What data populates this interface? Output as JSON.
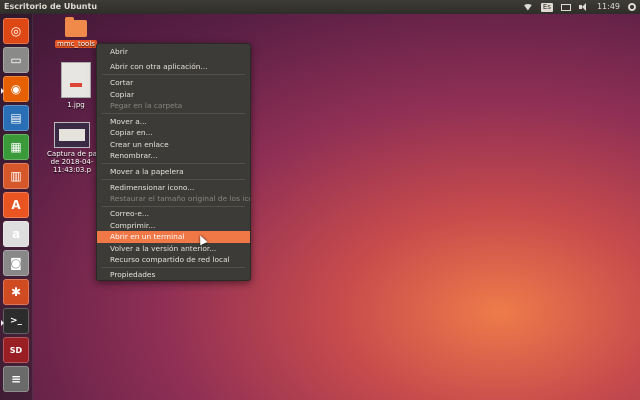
{
  "topbar": {
    "title": "Escritorio de Ubuntu",
    "keyboard_layout": "Es",
    "time": "11:49",
    "icons": [
      "wifi-icon",
      "keyboard-icon",
      "envelope-icon",
      "speaker-icon",
      "gear-icon"
    ]
  },
  "launcher": {
    "items": [
      {
        "name": "ubuntu-dash",
        "glyph": "◎",
        "color": "#dd4814"
      },
      {
        "name": "files",
        "glyph": "▭",
        "color": "#8a8a88"
      },
      {
        "name": "firefox",
        "glyph": "◉",
        "color": "#e66000"
      },
      {
        "name": "libreoffice-writer",
        "glyph": "▤",
        "color": "#2a6fb5"
      },
      {
        "name": "libreoffice-calc",
        "glyph": "▦",
        "color": "#3a9a3a"
      },
      {
        "name": "libreoffice-impress",
        "glyph": "▥",
        "color": "#d6572a"
      },
      {
        "name": "ubuntu-software",
        "glyph": "A",
        "color": "#e95420"
      },
      {
        "name": "amazon",
        "glyph": "a",
        "color": "#dedede"
      },
      {
        "name": "camera",
        "glyph": "◙",
        "color": "#888888"
      },
      {
        "name": "system-settings",
        "glyph": "✱",
        "color": "#d14b22"
      },
      {
        "name": "terminal",
        "glyph": ">_",
        "color": "#2c2c2c"
      },
      {
        "name": "sd-card",
        "glyph": "SD",
        "color": "#9a1f24"
      },
      {
        "name": "more",
        "glyph": "≡",
        "color": "#6a6a6a"
      }
    ]
  },
  "desktop": {
    "icons": [
      {
        "label": "mmc_tools",
        "type": "folder"
      },
      {
        "label": "1.jpg",
        "type": "image"
      },
      {
        "label_lines": [
          "Captura de pa",
          "de 2018-04-",
          "11:43:03.p"
        ],
        "type": "screenshot"
      }
    ]
  },
  "context_menu": {
    "items": [
      {
        "label": "Abrir",
        "state": "normal"
      },
      {
        "label": "Abrir con otra aplicación...",
        "state": "normal"
      },
      {
        "label": "Cortar",
        "state": "normal"
      },
      {
        "label": "Copiar",
        "state": "normal"
      },
      {
        "label": "Pegar en la carpeta",
        "state": "disabled"
      },
      {
        "label": "Mover a...",
        "state": "normal"
      },
      {
        "label": "Copiar en...",
        "state": "normal"
      },
      {
        "label": "Crear un enlace",
        "state": "normal"
      },
      {
        "label": "Renombrar...",
        "state": "normal"
      },
      {
        "label": "Mover a la papelera",
        "state": "normal"
      },
      {
        "label": "Redimensionar icono...",
        "state": "normal"
      },
      {
        "label": "Restaurar el tamaño original de los ico...",
        "state": "disabled"
      },
      {
        "label": "Correo-e...",
        "state": "normal"
      },
      {
        "label": "Comprimir...",
        "state": "normal"
      },
      {
        "label": "Abrir en un terminal",
        "state": "highlighted"
      },
      {
        "label": "Volver a la versión anterior...",
        "state": "normal"
      },
      {
        "label": "Recurso compartido de red local",
        "state": "normal"
      },
      {
        "label": "Propiedades",
        "state": "normal"
      }
    ]
  },
  "colors": {
    "accent": "#e95420",
    "menu_bg": "#3c3b37",
    "menu_highlight": "#f07746",
    "topbar_bg": "#2e2d29"
  }
}
